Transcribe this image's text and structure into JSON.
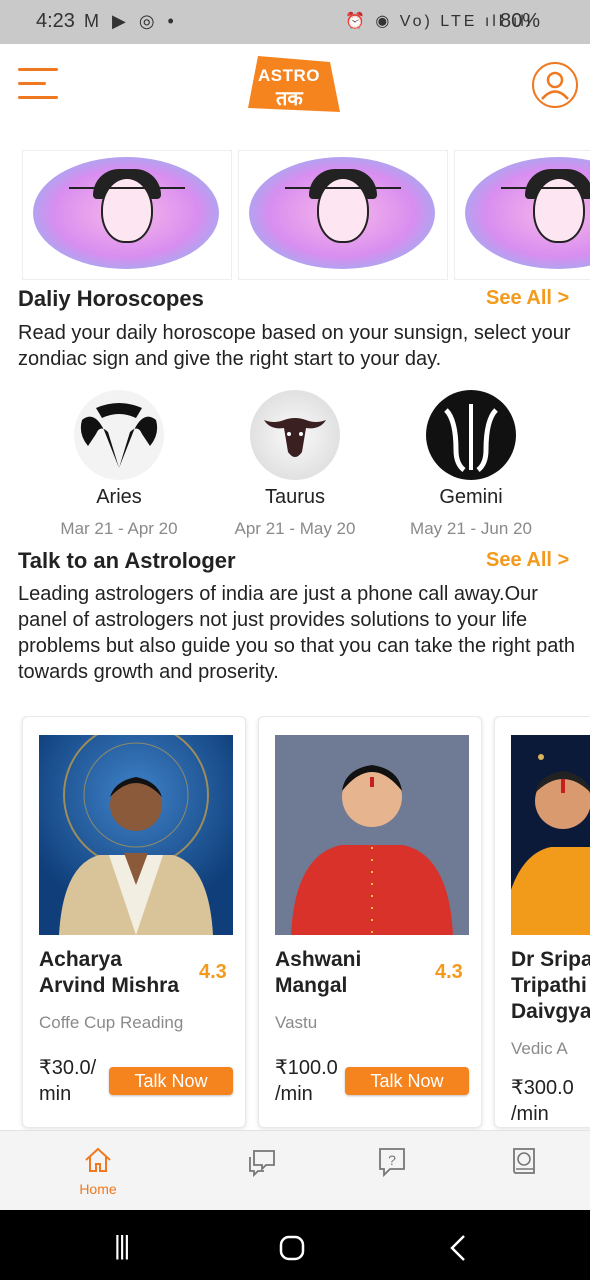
{
  "status_bar": {
    "time": "4:23",
    "left_icons": [
      "gmail-icon",
      "play-icon",
      "whatsapp-icon",
      "dot"
    ],
    "right_icons": "⏰ ◉ Vo) LTE ıll ıll",
    "battery": "80%"
  },
  "header": {
    "logo_line1": "ASTRO",
    "logo_line2": "तक",
    "logo_color": "#f5841f"
  },
  "horoscopes": {
    "title": "Daliy Horoscopes",
    "see_all": "See All >",
    "description": "Read your daily horoscope based on your sunsign, select your zondiac sign and give the right start to your day.",
    "signs": [
      {
        "name": "Aries",
        "dates": "Mar 21 - Apr 20"
      },
      {
        "name": "Taurus",
        "dates": "Apr 21 - May 20"
      },
      {
        "name": "Gemini",
        "dates": "May 21 - Jun 20"
      }
    ]
  },
  "astrologers": {
    "title": "Talk to an Astrologer",
    "see_all": "See All >",
    "description": "Leading astrologers of india are just a phone call away.Our panel of astrologers not just provides solutions to your life problems but also guide you so that you can take the right path towards growth and proserity.",
    "cards": [
      {
        "name": "Acharya Arvind  Mishra",
        "rating": "4.3",
        "specialty": "Coffe Cup Reading",
        "price": "₹30.0/ min",
        "cta": "Talk Now"
      },
      {
        "name": "Ashwani Mangal",
        "rating": "4.3",
        "specialty": "Vastu",
        "price": "₹100.0 /min",
        "cta": "Talk Now"
      },
      {
        "name": "Dr Sripati Tripathi Daivgya",
        "rating": "",
        "specialty": "Vedic A",
        "price": "₹300.0 /min",
        "cta": ""
      }
    ]
  },
  "bottom_nav": {
    "items": [
      {
        "label": "Home",
        "icon": "home-icon",
        "active": true
      },
      {
        "label": "",
        "icon": "chat-icon",
        "active": false
      },
      {
        "label": "",
        "icon": "question-icon",
        "active": false
      },
      {
        "label": "",
        "icon": "book-icon",
        "active": false
      }
    ],
    "active_color": "#f07820"
  },
  "system_nav": {
    "recents": "|||",
    "home": "○",
    "back": "<"
  }
}
